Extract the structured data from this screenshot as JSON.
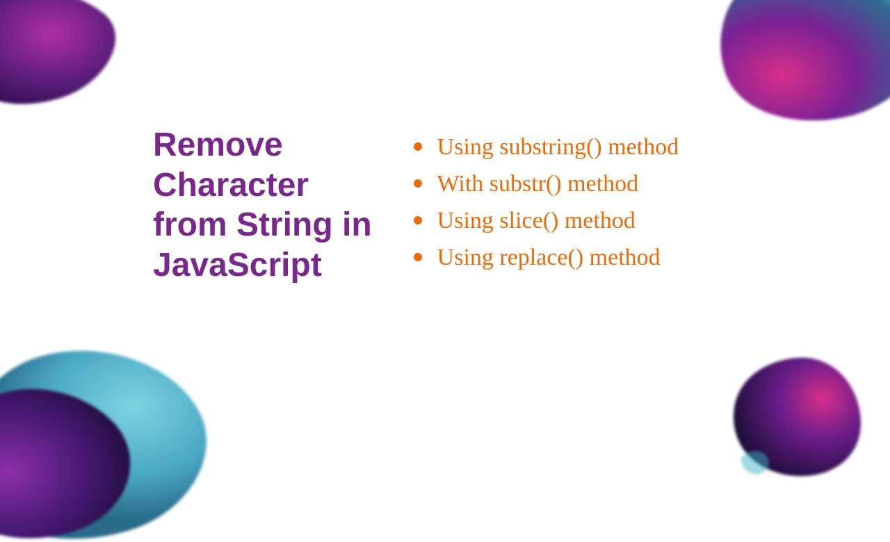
{
  "heading": "Remove\nCharacter\nfrom String in\nJavaScript",
  "items": [
    "Using substring() method",
    "With substr() method",
    "Using slice() method",
    "Using replace() method"
  ],
  "colors": {
    "heading": "#78278b",
    "list": "#e86c0a"
  }
}
